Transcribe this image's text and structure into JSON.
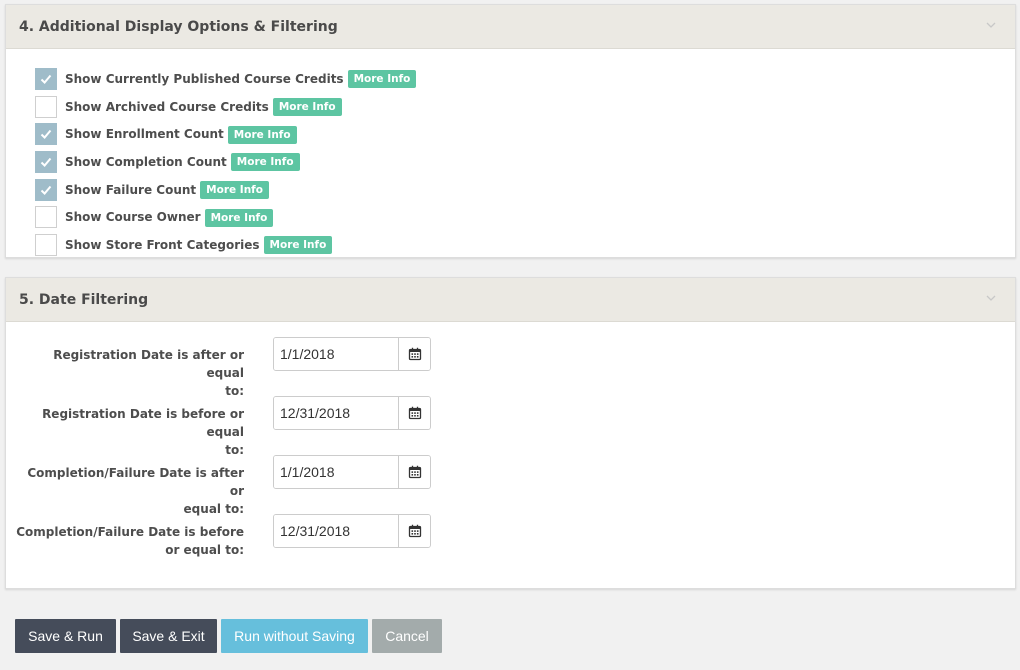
{
  "section4": {
    "title": "4. Additional Display Options & Filtering",
    "more_info_label": "More Info",
    "options": [
      {
        "label": "Show Currently Published Course Credits",
        "checked": true
      },
      {
        "label": "Show Archived Course Credits",
        "checked": false
      },
      {
        "label": "Show Enrollment Count",
        "checked": true
      },
      {
        "label": "Show Completion Count",
        "checked": true
      },
      {
        "label": "Show Failure Count",
        "checked": true
      },
      {
        "label": "Show Course Owner",
        "checked": false
      },
      {
        "label": "Show Store Front Categories",
        "checked": false
      }
    ]
  },
  "section5": {
    "title": "5. Date Filtering",
    "fields": [
      {
        "label_line1": "Registration Date is after or equal",
        "label_line2": "to:",
        "value": "1/1/2018"
      },
      {
        "label_line1": "Registration Date is before or equal",
        "label_line2": "to:",
        "value": "12/31/2018"
      },
      {
        "label_line1": "Completion/Failure Date is after or",
        "label_line2": "equal to:",
        "value": "1/1/2018"
      },
      {
        "label_line1": "Completion/Failure Date is before",
        "label_line2": "or equal to:",
        "value": "12/31/2018"
      }
    ]
  },
  "actions": {
    "save_run": "Save & Run",
    "save_exit": "Save & Exit",
    "run_without_saving": "Run without Saving",
    "cancel": "Cancel"
  },
  "colors": {
    "checkbox_checked": "#9fbcc9",
    "badge": "#5dc5a2",
    "btn_dark": "#454c5a",
    "btn_blue": "#66bfdc",
    "btn_gray": "#a3abab"
  },
  "icons": {
    "collapse": "chevron-down-icon",
    "check": "check-icon",
    "calendar": "calendar-icon"
  }
}
